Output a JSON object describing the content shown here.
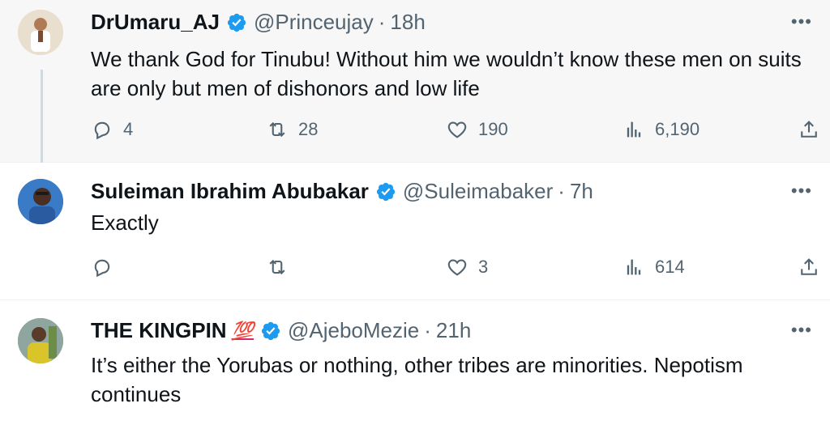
{
  "tweets": [
    {
      "name": "DrUmaru_AJ",
      "handle": "@Princeujay",
      "separator": "·",
      "time": "18h",
      "text": "We thank God for Tinubu! Without him we wouldn’t know these men on suits are only but men of dishonors and low life",
      "replies": "4",
      "retweets": "28",
      "likes": "190",
      "views": "6,190"
    },
    {
      "name": "Suleiman Ibrahim Abubakar",
      "handle": "@Suleimabaker",
      "separator": "·",
      "time": "7h",
      "text": "Exactly",
      "replies": "",
      "retweets": "",
      "likes": "3",
      "views": "614"
    },
    {
      "name": "THE KINGPIN",
      "emoji": "💯",
      "handle": "@AjeboMezie",
      "separator": "·",
      "time": "21h",
      "text": "It’s either the Yorubas or nothing, other tribes are minorities. Nepotism continues"
    }
  ],
  "icons": {
    "more": "•••",
    "verified_color": "#1d9bf0"
  }
}
